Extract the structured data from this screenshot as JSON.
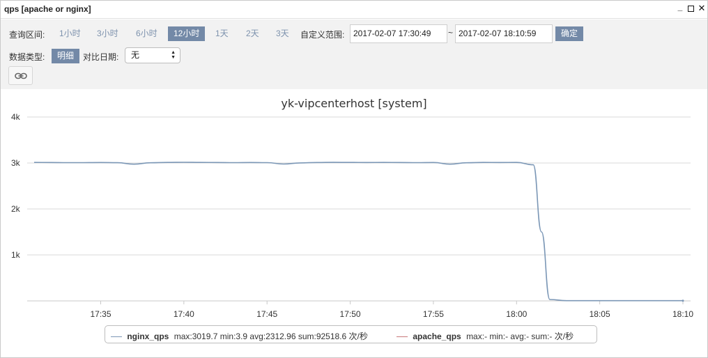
{
  "window": {
    "title": "qps [apache or nginx]",
    "min_icon": "minimize-icon",
    "max_icon": "maximize-icon",
    "close_icon": "close-icon"
  },
  "toolbar": {
    "range_label": "查询区间:",
    "ranges": [
      "1小时",
      "3小时",
      "6小时",
      "12小时",
      "1天",
      "2天",
      "3天"
    ],
    "active_range": "12小时",
    "custom_range_label": "自定义范围:",
    "start_time": "2017-02-07 17:30:49",
    "separator": "~",
    "end_time": "2017-02-07 18:10:59",
    "confirm_label": "确定",
    "data_type_label": "数据类型:",
    "data_type_value": "明细",
    "compare_label": "对比日期:",
    "compare_value": "无",
    "link_icon": "link-icon"
  },
  "colors": {
    "accent": "#7389a7",
    "nginx_line": "#7b97b6",
    "apache_line": "#c8787a"
  },
  "chart_data": {
    "type": "line",
    "title": "yk-vipcenterhost [system]",
    "yticks": [
      "4k",
      "3k",
      "2k",
      "1k"
    ],
    "xticks": [
      "17:35",
      "17:40",
      "17:45",
      "17:50",
      "17:55",
      "18:00",
      "18:05",
      "18:10"
    ],
    "ylim": [
      0,
      4000
    ],
    "xlim": [
      "17:31",
      "18:10"
    ],
    "grid": true,
    "legend_position": "bottom",
    "series": [
      {
        "name": "nginx_qps",
        "stats": "max:3019.7 min:3.9 avg:2312.96 sum:92518.6 次/秒",
        "color": "#7b97b6",
        "x": [
          "17:31",
          "17:32",
          "17:33",
          "17:34",
          "17:35",
          "17:36",
          "17:37",
          "17:38",
          "17:39",
          "17:40",
          "17:41",
          "17:42",
          "17:43",
          "17:44",
          "17:45",
          "17:46",
          "17:47",
          "17:48",
          "17:49",
          "17:50",
          "17:51",
          "17:52",
          "17:53",
          "17:54",
          "17:55",
          "17:56",
          "17:57",
          "17:58",
          "17:59",
          "18:00",
          "18:01",
          "18:01.5",
          "18:02",
          "18:03",
          "18:04",
          "18:05",
          "18:06",
          "18:07",
          "18:08",
          "18:09",
          "18:10"
        ],
        "values": [
          3012,
          3010,
          3008,
          3008,
          3010,
          3006,
          2975,
          3005,
          3012,
          3015,
          3012,
          3010,
          3008,
          3010,
          3008,
          2978,
          3002,
          3010,
          3014,
          3012,
          3010,
          3012,
          3010,
          3008,
          3010,
          2975,
          3005,
          3012,
          3010,
          3012,
          2960,
          1500,
          30,
          5,
          4,
          4,
          4,
          4,
          4,
          4,
          4
        ]
      },
      {
        "name": "apache_qps",
        "stats": "max:- min:- avg:- sum:- 次/秒",
        "color": "#c8787a",
        "x": [],
        "values": []
      }
    ]
  }
}
